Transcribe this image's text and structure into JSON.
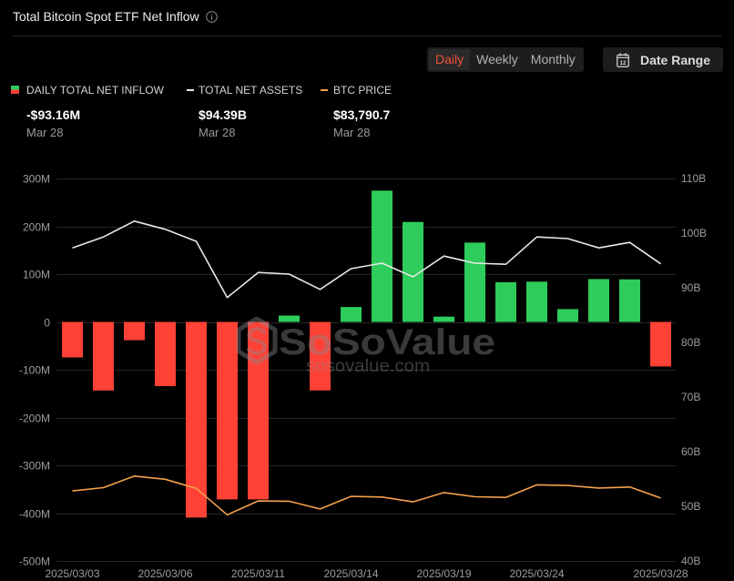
{
  "tabs": [
    {
      "label": "Daily",
      "active": true
    },
    {
      "label": "Weekly",
      "active": false
    },
    {
      "label": "Monthly",
      "active": false
    }
  ],
  "date_range": {
    "label": "Date Range",
    "icon": "calendar-icon",
    "icon_day": "12"
  },
  "icons": {
    "info": "info-icon"
  },
  "watermark": {
    "brand": "SoSoValue",
    "url": "sosovalue.com",
    "icon": "sosovalue-logo-icon"
  },
  "colors": {
    "background": "#000000",
    "inflow_positive": "#2ecc5b",
    "inflow_negative": "#ff4136",
    "net_assets_line": "#e8e8e8",
    "btc_price_line": "#f5a04c",
    "active_tab": "#f0503c"
  },
  "chart_data": {
    "type": "bar",
    "title": "Total Bitcoin Spot ETF Net Inflow",
    "x": [
      "2025/03/03",
      "2025/03/04",
      "2025/03/05",
      "2025/03/06",
      "2025/03/07",
      "2025/03/10",
      "2025/03/11",
      "2025/03/12",
      "2025/03/13",
      "2025/03/14",
      "2025/03/17",
      "2025/03/18",
      "2025/03/19",
      "2025/03/20",
      "2025/03/21",
      "2025/03/24",
      "2025/03/25",
      "2025/03/26",
      "2025/03/27",
      "2025/03/28"
    ],
    "x_ticks": [
      "2025/03/03",
      "2025/03/06",
      "2025/03/11",
      "2025/03/14",
      "2025/03/19",
      "2025/03/24",
      "2025/03/28"
    ],
    "y_left": {
      "range": [
        -500,
        300
      ],
      "ticks": [
        {
          "value": 300,
          "label": "300M"
        },
        {
          "value": 200,
          "label": "200M"
        },
        {
          "value": 100,
          "label": "100M"
        },
        {
          "value": 0,
          "label": "0"
        },
        {
          "value": -100,
          "label": "-100M"
        },
        {
          "value": -200,
          "label": "-200M"
        },
        {
          "value": -300,
          "label": "-300M"
        },
        {
          "value": -400,
          "label": "-400M"
        },
        {
          "value": -500,
          "label": "-500M"
        }
      ]
    },
    "y_right": {
      "range": [
        40,
        110
      ],
      "ticks": [
        {
          "value": 110,
          "label": "110B"
        },
        {
          "value": 100,
          "label": "100B"
        },
        {
          "value": 90,
          "label": "90B"
        },
        {
          "value": 80,
          "label": "80B"
        },
        {
          "value": 70,
          "label": "70B"
        },
        {
          "value": 60,
          "label": "60B"
        },
        {
          "value": 50,
          "label": "50B"
        },
        {
          "value": 40,
          "label": "40B"
        }
      ]
    },
    "series": [
      {
        "name": "DAILY TOTAL NET INFLOW",
        "type": "bar",
        "y_axis": "left",
        "values": [
          -74.2,
          -143.4,
          -38.3,
          -134.3,
          -409.2,
          -371.2,
          -371.2,
          13.3,
          -143.3,
          31.2,
          274.6,
          209.1,
          11.1,
          165.9,
          83.1,
          84.2,
          26.8,
          89.6,
          89.0,
          -93.16
        ],
        "latest": {
          "value": "-$93.16M",
          "date": "Mar 28"
        }
      },
      {
        "name": "TOTAL NET ASSETS",
        "type": "line",
        "y_axis": "right",
        "values": [
          97.3,
          99.3,
          102.2,
          100.7,
          98.5,
          88.2,
          92.8,
          92.5,
          89.7,
          93.5,
          94.5,
          92.0,
          95.8,
          94.5,
          94.3,
          99.3,
          99.0,
          97.3,
          98.3,
          94.39
        ],
        "latest": {
          "value": "$94.39B",
          "date": "Mar 28"
        }
      },
      {
        "name": "BTC PRICE",
        "type": "line",
        "values": [
          86000,
          87000,
          90600,
          89600,
          86800,
          78600,
          82900,
          82800,
          80400,
          84300,
          84100,
          82600,
          85500,
          84200,
          84000,
          87900,
          87700,
          86900,
          87200,
          83790.7
        ],
        "latest": {
          "value": "$83,790.7",
          "date": "Mar 28"
        }
      }
    ],
    "grid": true,
    "legend_position": "top-left"
  }
}
